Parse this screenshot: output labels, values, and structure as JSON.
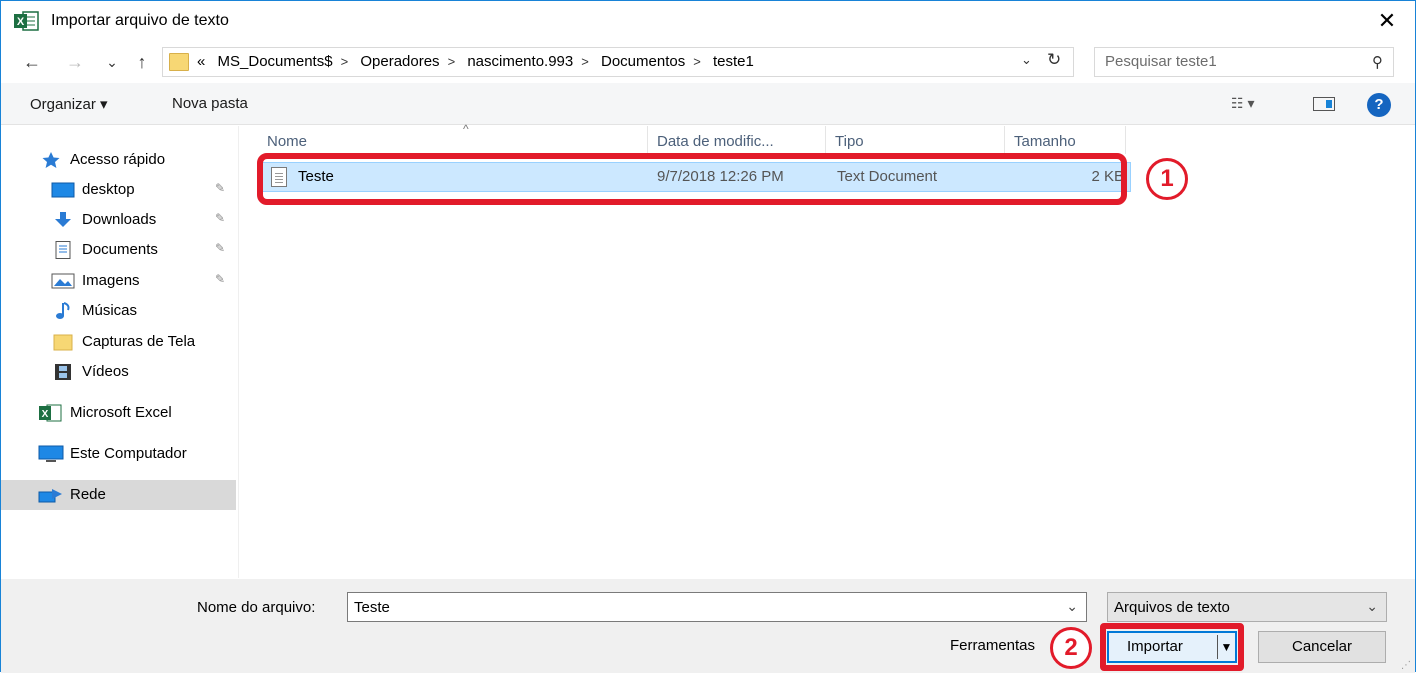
{
  "window": {
    "title": "Importar arquivo de texto",
    "close_glyph": "✕"
  },
  "nav": {
    "back_glyph": "←",
    "forward_glyph": "→",
    "recent_glyph": "⌄",
    "up_glyph": "↑",
    "breadcrumb": [
      "«",
      "MS_Documents$",
      "Operadores",
      "nascimento.993",
      "Documentos",
      "teste1"
    ],
    "refresh_glyph": "↻",
    "dropdown_glyph": "⌄",
    "search_placeholder": "Pesquisar teste1",
    "search_glyph": "⚲"
  },
  "toolbar": {
    "organize": "Organizar ▾",
    "new_folder": "Nova pasta",
    "view_glyph": "☷ ▾",
    "help_glyph": "?"
  },
  "sidebar": {
    "quick_access": "Acesso rápido",
    "items": [
      {
        "label": "desktop",
        "pinned": true
      },
      {
        "label": "Downloads",
        "pinned": true
      },
      {
        "label": "Documents",
        "pinned": true
      },
      {
        "label": "Imagens",
        "pinned": true
      },
      {
        "label": "Músicas",
        "pinned": false
      },
      {
        "label": "Capturas de Tela",
        "pinned": false
      },
      {
        "label": "Vídeos",
        "pinned": false
      }
    ],
    "excel": "Microsoft Excel",
    "computer": "Este Computador",
    "network": "Rede",
    "pin_glyph": "📌"
  },
  "filelist": {
    "columns": [
      "Nome",
      "Data de modific...",
      "Tipo",
      "Tamanho"
    ],
    "sort_glyph": "^",
    "rows": [
      {
        "name": "Teste",
        "date": "9/7/2018 12:26 PM",
        "type": "Text Document",
        "size": "2 KB"
      }
    ]
  },
  "annotations": [
    "1",
    "2"
  ],
  "bottom": {
    "filename_label": "Nome do arquivo:",
    "filename_value": "Teste",
    "filetype_value": "Arquivos de texto",
    "tools_label": "Ferramentas",
    "import_label": "Importar",
    "cancel_label": "Cancelar"
  },
  "colors": {
    "accent": "#0078d7",
    "highlight": "#e21b2a",
    "selection": "#cce8ff",
    "excel_green": "#1d6f42"
  }
}
